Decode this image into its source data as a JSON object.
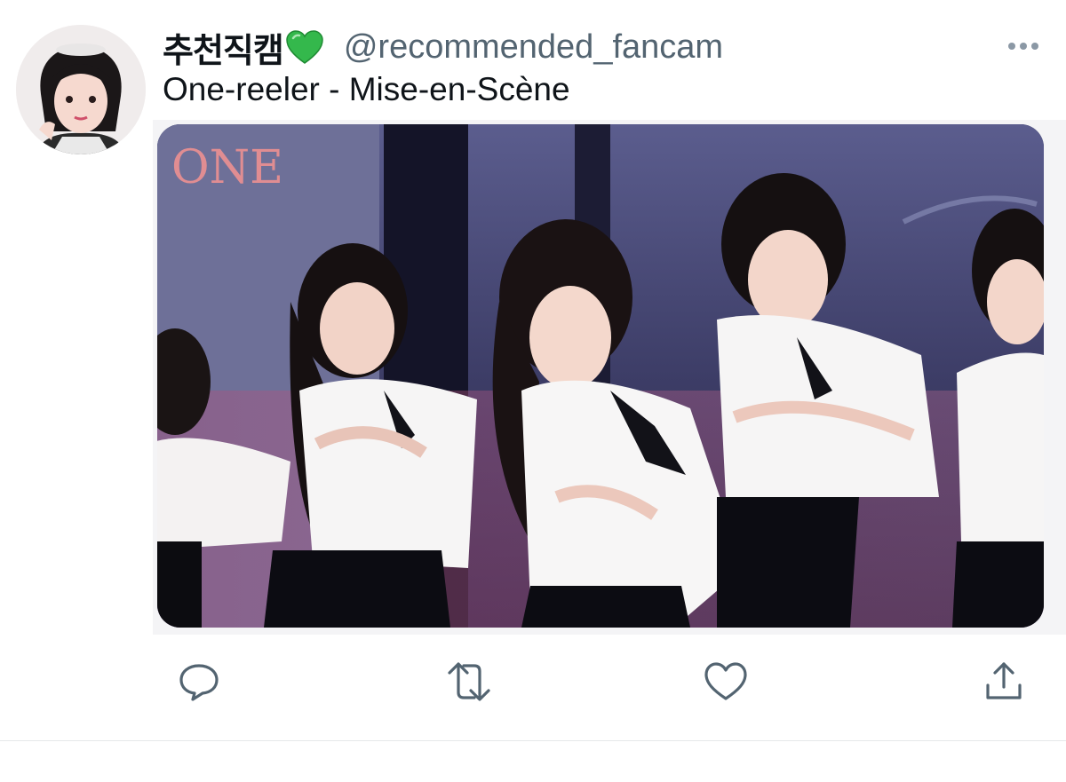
{
  "tweet": {
    "display_name": "추천직캠",
    "handle": "@recommended_fancam",
    "text": "One-reeler - Mise-en-Scène",
    "media_overlay_text": "ONE"
  },
  "icons": {
    "verified": "green-heart-icon",
    "reply": "reply-icon",
    "retweet": "retweet-icon",
    "like": "like-icon",
    "share": "share-icon",
    "more": "more-icon"
  },
  "colors": {
    "name": "#0f1419",
    "handle": "#536471",
    "icon": "#536471",
    "heart_accent": "#2fb64a"
  }
}
